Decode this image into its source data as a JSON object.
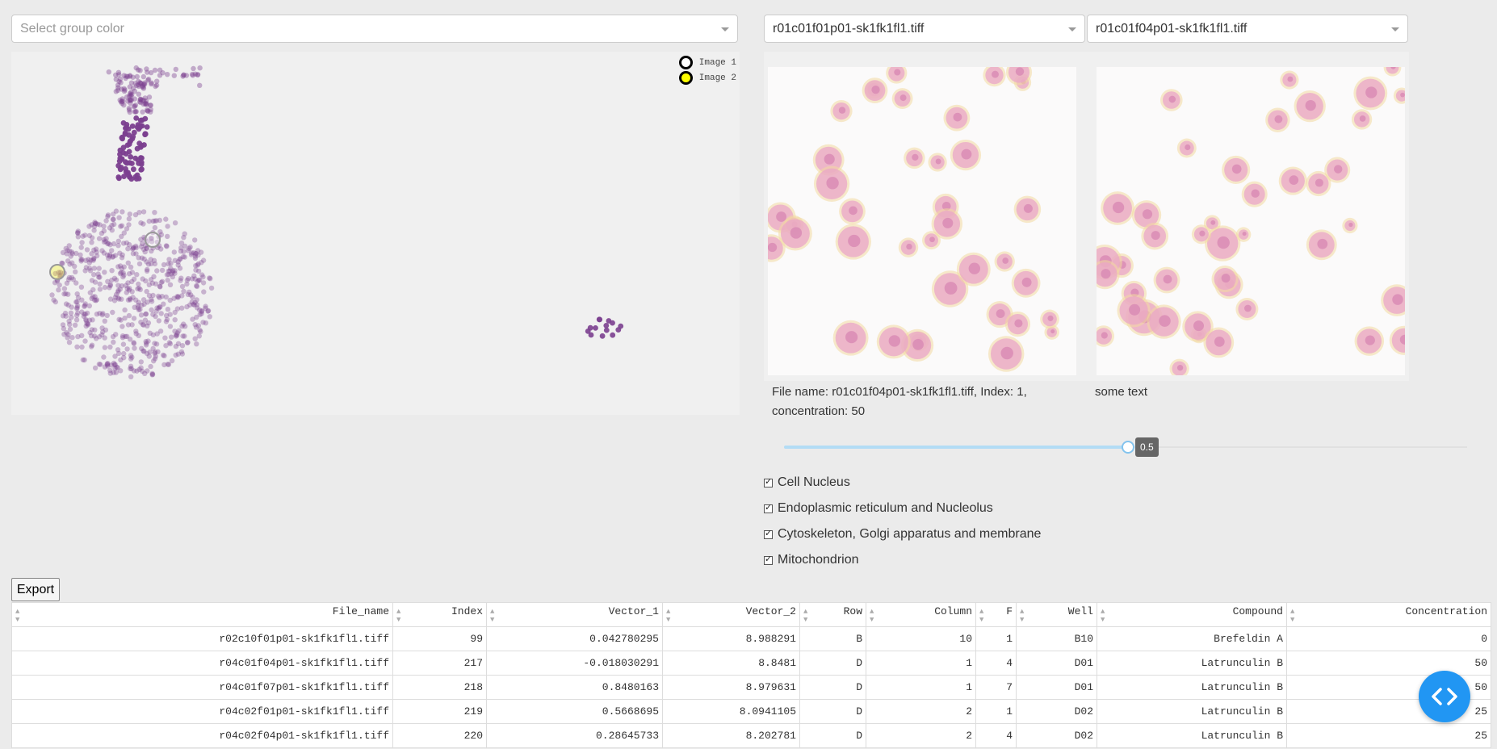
{
  "group_color_select": {
    "placeholder": "Select group color"
  },
  "image_select_1": {
    "value": "r01c01f01p01-sk1fk1fl1.tiff"
  },
  "image_select_2": {
    "value": "r01c01f04p01-sk1fk1fl1.tiff"
  },
  "legend": {
    "items": [
      {
        "label": "Image 1",
        "fill": "#ffffff",
        "stroke": "#000000"
      },
      {
        "label": "Image 2",
        "fill": "#ffff00",
        "stroke": "#000000"
      }
    ]
  },
  "caption_1": "File name: r01c01f04p01-sk1fk1fl1.tiff, Index: 1, concentration: 50",
  "caption_2": "some text",
  "slider": {
    "value": "0.5",
    "fraction": 0.5
  },
  "channels": [
    {
      "label": "Cell Nucleus",
      "checked": true
    },
    {
      "label": "Endoplasmic reticulum and Nucleolus",
      "checked": true
    },
    {
      "label": "Cytoskeleton, Golgi apparatus and membrane",
      "checked": true
    },
    {
      "label": "Mitochondrion",
      "checked": true
    }
  ],
  "export_label": "Export",
  "table": {
    "headers": [
      "File_name",
      "Index",
      "Vector_1",
      "Vector_2",
      "Row",
      "Column",
      "F",
      "Well",
      "Compound",
      "Concentration"
    ],
    "rows": [
      [
        "r02c10f01p01-sk1fk1fl1.tiff",
        "99",
        "0.042780295",
        "8.988291",
        "B",
        "10",
        "1",
        "B10",
        "Brefeldin A",
        "0"
      ],
      [
        "r04c01f04p01-sk1fk1fl1.tiff",
        "217",
        "-0.018030291",
        "8.8481",
        "D",
        "1",
        "4",
        "D01",
        "Latrunculin B",
        "50"
      ],
      [
        "r04c01f07p01-sk1fk1fl1.tiff",
        "218",
        "0.8480163",
        "8.979631",
        "D",
        "1",
        "7",
        "D01",
        "Latrunculin B",
        "50"
      ],
      [
        "r04c02f01p01-sk1fk1fl1.tiff",
        "219",
        "0.5668695",
        "8.0941105",
        "D",
        "2",
        "1",
        "D02",
        "Latrunculin B",
        "25"
      ],
      [
        "r04c02f04p01-sk1fk1fl1.tiff",
        "220",
        "0.28645733",
        "8.202781",
        "D",
        "2",
        "4",
        "D02",
        "Latrunculin B",
        "25"
      ]
    ]
  },
  "colors": {
    "point": "#7b3f8f",
    "accent": "#2196f3"
  }
}
